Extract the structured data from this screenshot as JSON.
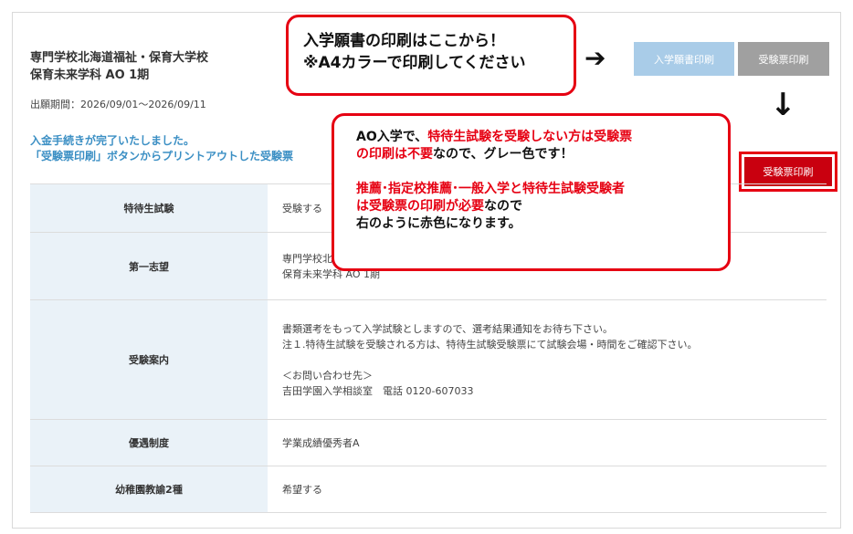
{
  "header": {
    "school_name": "専門学校北海道福祉・保育大学校",
    "department": "保育未来学科 AO 1期",
    "period": "出願期間：2026/09/01〜2026/09/11"
  },
  "notice": {
    "line1": "入金手続きが完了いたしました。",
    "line2": "「受験票印刷」ボタンからプリントアウトした受験票"
  },
  "buttons": {
    "application_print": "入学願書印刷",
    "exam_ticket_print": "受験票印刷",
    "exam_ticket_print_red": "受験票印刷"
  },
  "table": {
    "rows": [
      {
        "label": "特待生試験",
        "value": "受験する"
      },
      {
        "label": "第一志望",
        "value_lines": [
          "専門学校北",
          "保育未来学科 AO 1期"
        ]
      },
      {
        "label": "受験案内",
        "value_lines": [
          "書類選考をもって入学試験としますので、選考結果通知をお待ち下さい。",
          "注１.特待生試験を受験される方は、特待生試験受験票にて試験会場・時間をご確認下さい。",
          "",
          "＜お問い合わせ先＞",
          "吉田学園入学相談室　電話 0120-607033"
        ]
      },
      {
        "label": "優遇制度",
        "value": "学業成績優秀者A"
      },
      {
        "label": "幼稚園教諭2種",
        "value": "希望する"
      }
    ]
  },
  "callout_top": {
    "line1": "入学願書の印刷はここから！",
    "line2": "※A4カラーで印刷してください"
  },
  "callout_mid": {
    "l1a": "AO入学で、",
    "l1b": "特待生試験を受験しない方は受験票",
    "l2a": "の印刷は不要",
    "l2b": "なので、グレー色です！",
    "l3": "推薦･指定校推薦･一般入学と特待生試験受験者",
    "l4a": "は受験票の印刷が必要",
    "l4b": "なので",
    "l5": "右のように赤色になります。"
  },
  "icons": {
    "arrow_right": "arrow-right-icon",
    "arrow_down": "arrow-down-icon"
  },
  "colors": {
    "accent_red": "#e60012",
    "button_red": "#c9000f",
    "button_gray": "#a0a0a0",
    "button_blue": "#a9cce8",
    "notice_blue": "#3b8fc4",
    "table_header": "#eaf2f8"
  }
}
